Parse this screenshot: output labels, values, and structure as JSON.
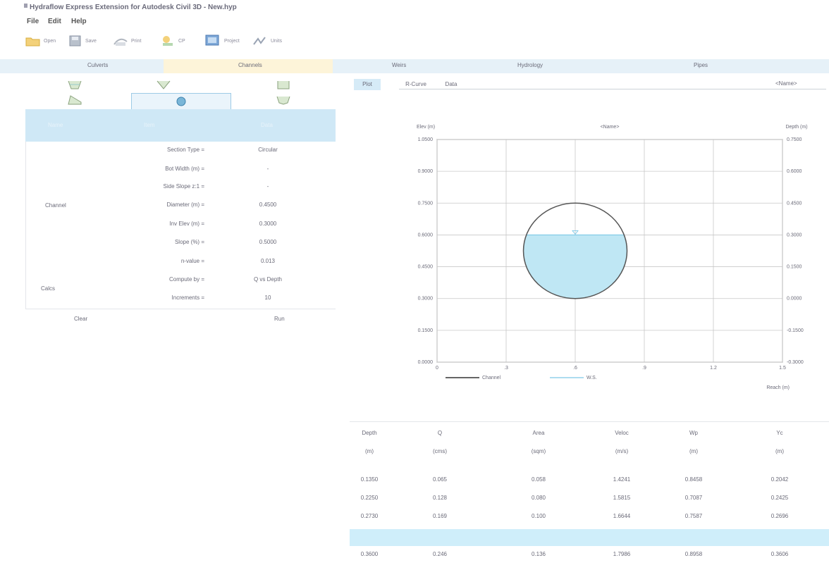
{
  "window": {
    "title": "Hydraflow Express Extension for Autodesk Civil 3D - New.hyp"
  },
  "menu": [
    "File",
    "Edit",
    "Help"
  ],
  "toolbar": {
    "items": [
      {
        "label": "Open",
        "icon": "folder-open-icon"
      },
      {
        "label": "Save",
        "icon": "save-icon"
      },
      {
        "label": "Print",
        "icon": "print-icon"
      },
      {
        "label": "CP",
        "icon": "cp-icon"
      },
      {
        "label": "Project",
        "icon": "project-icon"
      },
      {
        "label": "Units",
        "icon": "units-icon"
      }
    ]
  },
  "tabs": {
    "culverts": "Culverts",
    "channels": "Channels",
    "weirs": "Weirs",
    "hydrology": "Hydrology",
    "pipes": "Pipes"
  },
  "section_types": [
    "trapezoidal",
    "triangular",
    "rectangular",
    "gutter",
    "circular",
    "user-defined"
  ],
  "params_header": {
    "c1": "Name",
    "c2": "Item",
    "c3": "Data"
  },
  "params": [
    {
      "label": "Section Type =",
      "value": "Circular"
    },
    {
      "label": "Bot Width (m) =",
      "value": "-"
    },
    {
      "label": "Side Slope z:1 =",
      "value": "-"
    },
    {
      "label": "Diameter (m) =",
      "value": "0.4500"
    },
    {
      "label": "Inv Elev (m) =",
      "value": "0.3000"
    },
    {
      "label": "Slope (%) =",
      "value": "0.5000"
    },
    {
      "label": "n-value =",
      "value": "0.013"
    },
    {
      "label": "Compute by =",
      "value": "Q vs Depth"
    },
    {
      "label": "Increments =",
      "value": "10"
    }
  ],
  "groups": {
    "channel": "Channel",
    "calcs": "Calcs"
  },
  "links": {
    "clear": "Clear",
    "run": "Run"
  },
  "subtabs": [
    "Plot",
    "R-Curve",
    "Data"
  ],
  "plot_side_label": "<Name>",
  "plot_header_placeholder": "<Name>",
  "chart_data": {
    "type": "line",
    "title": "<Name>",
    "ylabel": "Elev (m)",
    "y2label": "Depth (m)",
    "xlabel": "Reach (m)",
    "x_ticks": [
      "0",
      ".3",
      ".6",
      ".9",
      "1.2",
      "1.5"
    ],
    "xlim": [
      0,
      1.5
    ],
    "y_ticks": [
      "1.0500",
      "0.9000",
      "0.7500",
      "0.6000",
      "0.4500",
      "0.3000",
      "0.1500",
      "0.0000"
    ],
    "ylim": [
      0,
      1.05
    ],
    "y2_ticks": [
      "0.7500",
      "0.6000",
      "0.4500",
      "0.3000",
      "0.1500",
      "0.0000",
      "-0.1500",
      "-0.3000"
    ],
    "grid": true,
    "channel": {
      "type": "circle",
      "center_x": 0.6,
      "invert": 0.3,
      "diameter": 0.45
    },
    "water_depth": 0.3,
    "legend": [
      "Channel",
      "W.S."
    ],
    "legend_position": "bottom",
    "colors": {
      "channel": "#555555",
      "water": "#bfe7f4",
      "ws_line": "#7cc8e6",
      "grid": "#c8c8c8"
    }
  },
  "table": {
    "headers": [
      "Depth",
      "Q",
      "Area",
      "Veloc",
      "Wp",
      "Yc"
    ],
    "units": [
      "(m)",
      "(cms)",
      "(sqm)",
      "(m/s)",
      "(m)",
      "(m)"
    ],
    "rows": [
      [
        "0.1350",
        "0.065",
        "0.058",
        "1.4241",
        "0.8458",
        "0.2042"
      ],
      [
        "0.2250",
        "0.128",
        "0.080",
        "1.5815",
        "0.7087",
        "0.2425"
      ],
      [
        "0.2730",
        "0.169",
        "0.100",
        "1.6644",
        "0.7587",
        "0.2696"
      ],
      [
        "",
        "",
        "",
        "",
        "",
        ""
      ],
      [
        "0.3600",
        "0.246",
        "0.136",
        "1.7986",
        "0.8958",
        "0.3606"
      ]
    ],
    "highlight_row": 3
  }
}
